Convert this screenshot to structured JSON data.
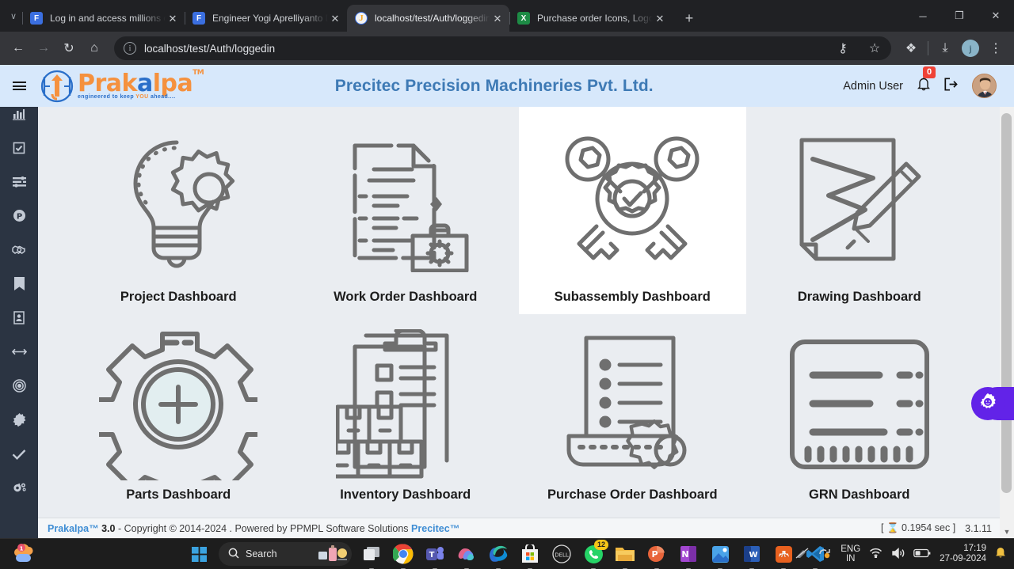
{
  "browser": {
    "tabs": [
      {
        "title": "Log in and access millions of graphic",
        "favicon": "figma-icon",
        "favicon_letter": "F",
        "active": false
      },
      {
        "title": "Engineer Yogi Aprelliyanto Detailed O",
        "favicon": "figma-icon",
        "favicon_letter": "F",
        "active": false
      },
      {
        "title": "localhost/test/Auth/loggedin",
        "favicon": "prakalpa-icon",
        "favicon_letter": "J",
        "active": true
      },
      {
        "title": "Purchase order Icons, Logos, Symbols",
        "favicon": "excel-icon",
        "favicon_letter": "X",
        "active": false
      }
    ],
    "new_tab_label": "+",
    "tab_close_label": "✕",
    "tablist_caret": "∨",
    "window_controls": {
      "minimize": "─",
      "maximize": "❐",
      "close": "✕"
    },
    "toolbar": {
      "back": "←",
      "forward": "→",
      "reload": "↻",
      "home": "⌂",
      "url": "localhost/test/Auth/loggedin",
      "site_info": "i",
      "password_key": "⚷",
      "bookmark_star": "☆",
      "extensions": "❖",
      "downloads": "⤓",
      "profile_letter": "j",
      "menu": "⋮"
    }
  },
  "app": {
    "brand": {
      "name_part1": "Prak",
      "name_part2": "a",
      "name_part3": "lpa",
      "tm": "TM",
      "tagline_pre": "engineered to keep ",
      "tagline_you": "YOU",
      "tagline_post": " ahead...."
    },
    "title": "Precitec Precision Machineries Pvt. Ltd.",
    "user_name": "Admin User",
    "notification_count": "0",
    "hamburger": "menu-icon",
    "logout": "logout-icon"
  },
  "sidebar": {
    "items": [
      {
        "name": "sidebar-item-reports",
        "icon": "bar-chart-icon"
      },
      {
        "name": "sidebar-item-tasks",
        "icon": "checkbox-icon"
      },
      {
        "name": "sidebar-item-lists",
        "icon": "list-settings-icon"
      },
      {
        "name": "sidebar-item-projects",
        "icon": "p-circle-icon"
      },
      {
        "name": "sidebar-item-vendors",
        "icon": "handshake-icon"
      },
      {
        "name": "sidebar-item-bookmarks",
        "icon": "bookmark-icon"
      },
      {
        "name": "sidebar-item-employees",
        "icon": "id-card-icon"
      },
      {
        "name": "sidebar-item-measure",
        "icon": "arrows-horizontal-icon"
      },
      {
        "name": "sidebar-item-targets",
        "icon": "target-icon"
      },
      {
        "name": "sidebar-item-quality",
        "icon": "gear-burst-icon"
      },
      {
        "name": "sidebar-item-approvals",
        "icon": "check-icon"
      },
      {
        "name": "sidebar-item-settings",
        "icon": "gears-icon"
      }
    ]
  },
  "dashboard": {
    "cards": [
      {
        "label": "Project Dashboard",
        "icon": "bulb-gear-icon",
        "hovered": false
      },
      {
        "label": "Work Order Dashboard",
        "icon": "document-briefcase-icon",
        "hovered": false
      },
      {
        "label": "Subassembly Dashboard",
        "icon": "wrench-gear-icon",
        "hovered": true
      },
      {
        "label": "Drawing Dashboard",
        "icon": "paper-pencil-icon",
        "hovered": false
      },
      {
        "label": "Parts Dashboard",
        "icon": "gear-plus-icon",
        "hovered": false
      },
      {
        "label": "Inventory Dashboard",
        "icon": "clipboard-boxes-icon",
        "hovered": false
      },
      {
        "label": "Purchase Order Dashboard",
        "icon": "invoice-gear-icon",
        "hovered": false
      },
      {
        "label": "GRN Dashboard",
        "icon": "receipt-icon",
        "hovered": false
      }
    ],
    "fab_icon": "gear-settings-icon"
  },
  "footer": {
    "brand": "Prakalpa™",
    "version": "3.0",
    "copyright": "- Copyright © 2014-2024 . Powered by PPMPL Software Solutions",
    "partner": "Precitec™",
    "timer_open": "[",
    "timer_icon": "⌛",
    "timer_value": "0.1954 sec",
    "timer_close": "]",
    "build": "3.1.11"
  },
  "taskbar": {
    "search_placeholder": "Search",
    "search_icon": "magnifier-icon",
    "start_icon": "windows-icon",
    "apps": [
      {
        "name": "taskview-icon",
        "label": ""
      },
      {
        "name": "chrome-icon",
        "label": ""
      },
      {
        "name": "teams-icon",
        "label": ""
      },
      {
        "name": "copilot-icon",
        "label": ""
      },
      {
        "name": "edge-icon",
        "label": ""
      },
      {
        "name": "store-icon",
        "label": ""
      },
      {
        "name": "dell-icon",
        "label": ""
      },
      {
        "name": "whatsapp-icon",
        "label": "12"
      },
      {
        "name": "folder-icon",
        "label": ""
      },
      {
        "name": "powerpoint-icon",
        "label": ""
      },
      {
        "name": "onenote-icon",
        "label": ""
      },
      {
        "name": "photos-icon",
        "label": ""
      },
      {
        "name": "word-icon",
        "label": ""
      },
      {
        "name": "xmind-icon",
        "label": ""
      },
      {
        "name": "vscode-icon",
        "label": ""
      }
    ],
    "tray": {
      "chevron": "∧",
      "language_line1": "ENG",
      "language_line2": "IN",
      "time": "17:19",
      "date": "27-09-2024"
    }
  },
  "colors": {
    "header_bg": "#d7e8fb",
    "header_title": "#3e7ab5",
    "sidebar_bg": "#2b3442",
    "page_bg": "#eaedf1",
    "accent_orange": "#f5913e",
    "accent_blue": "#2a6fc9",
    "badge_red": "#ef4236",
    "fab_purple": "#6223e8",
    "icon_gray": "#6f6f6f"
  }
}
